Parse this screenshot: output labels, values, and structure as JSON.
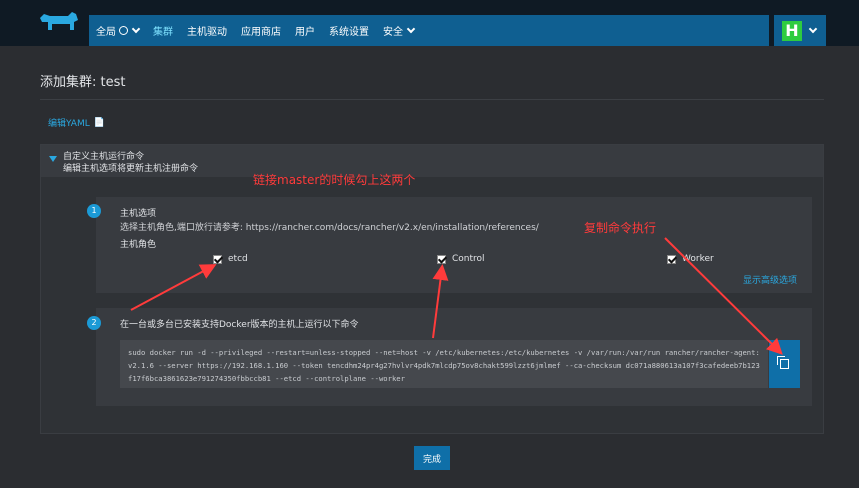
{
  "nav": {
    "global": "全局",
    "items": [
      "集群",
      "主机驱动",
      "应用商店",
      "用户",
      "系统设置",
      "安全"
    ]
  },
  "user": {
    "avatar_letter": "H"
  },
  "page": {
    "title": "添加集群: test",
    "edit_yaml": "编辑YAML"
  },
  "section": {
    "title": "自定义主机运行命令",
    "subtitle": "编辑主机选项将更新主机注册命令"
  },
  "step1": {
    "num": "1",
    "title": "主机选项",
    "desc": "选择主机角色,端口放行请参考: https://rancher.com/docs/rancher/v2.x/en/installation/references/",
    "roles_label": "主机角色",
    "roles": [
      "etcd",
      "Control",
      "Worker"
    ],
    "advanced": "显示高级选项"
  },
  "step2": {
    "num": "2",
    "title": "在一台或多台已安装支持Docker版本的主机上运行以下命令",
    "command": "sudo docker run -d --privileged --restart=unless-stopped --net=host -v /etc/kubernetes:/etc/kubernetes -v /var/run:/var/run rancher/rancher-agent:v2.1.6 --server https://192.168.1.160 --token tencdhm24pr4g27hvlvr4pdk7mlcdp75ov8chakt599lzzt6jmlmef --ca-checksum dc071a880613a107f3cafedeeb7b123f17f6bca3861623e791274350fbbccb81 --etcd --controlplane --worker"
  },
  "done": "完成",
  "annotations": {
    "note1": "链接master的时候勾上这两个",
    "note2": "复制命令执行"
  },
  "colors": {
    "accent": "#0f5f91",
    "annotation": "#ff3b3b"
  }
}
